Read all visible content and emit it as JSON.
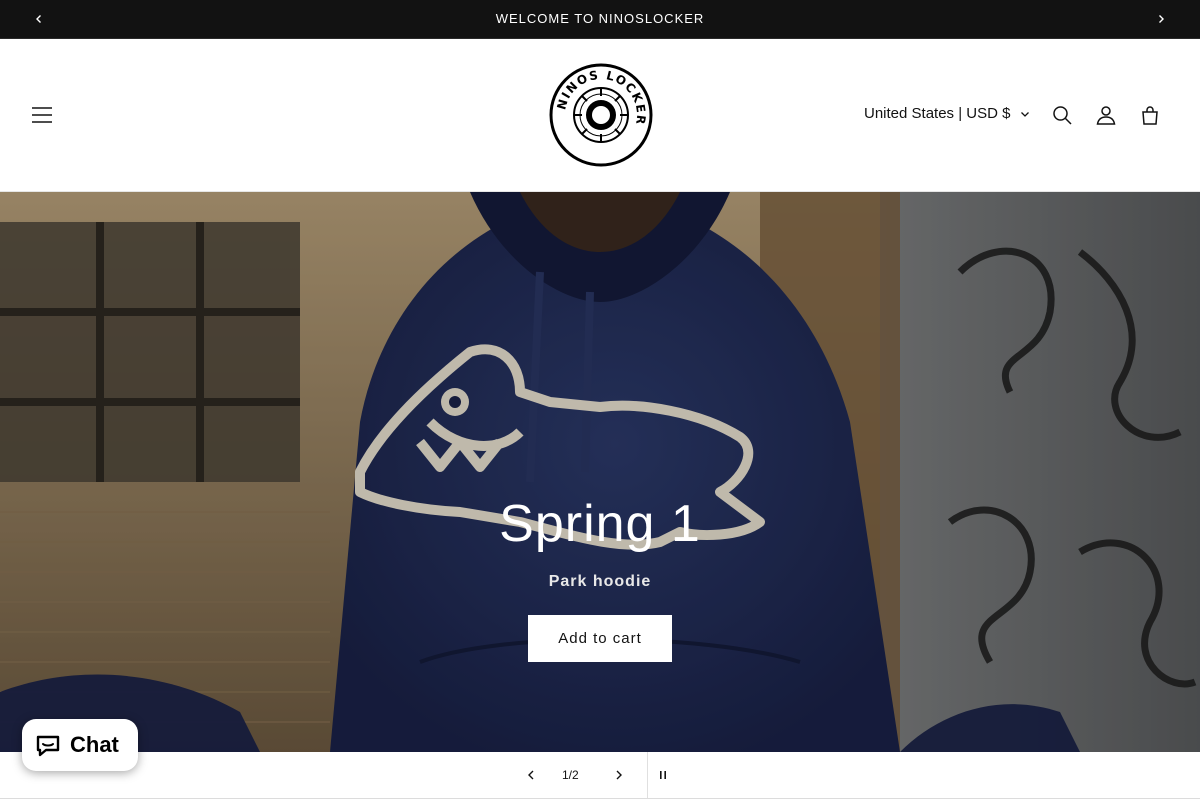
{
  "announcement": {
    "message": "WELCOME TO NINOSLOCKER",
    "prev_icon": "chevron-left-icon",
    "next_icon": "chevron-right-icon"
  },
  "header": {
    "menu_icon": "hamburger-icon",
    "logo_text": "NINOS LOCKER",
    "country_selector": "United States | USD $",
    "search_icon": "search-icon",
    "account_icon": "account-icon",
    "cart_icon": "cart-icon"
  },
  "hero": {
    "title": "Spring 1",
    "subtitle": "Park hoodie",
    "button_label": "Add to cart",
    "background": "person in navy hoodie with studded running-dog graphic"
  },
  "slider": {
    "counter": "1/2",
    "prev_icon": "chevron-left-icon",
    "next_icon": "chevron-right-icon",
    "pause_icon": "pause-icon"
  },
  "chat": {
    "label": "Chat",
    "icon": "chat-bubble-icon",
    "accent": "#5a31f4"
  }
}
